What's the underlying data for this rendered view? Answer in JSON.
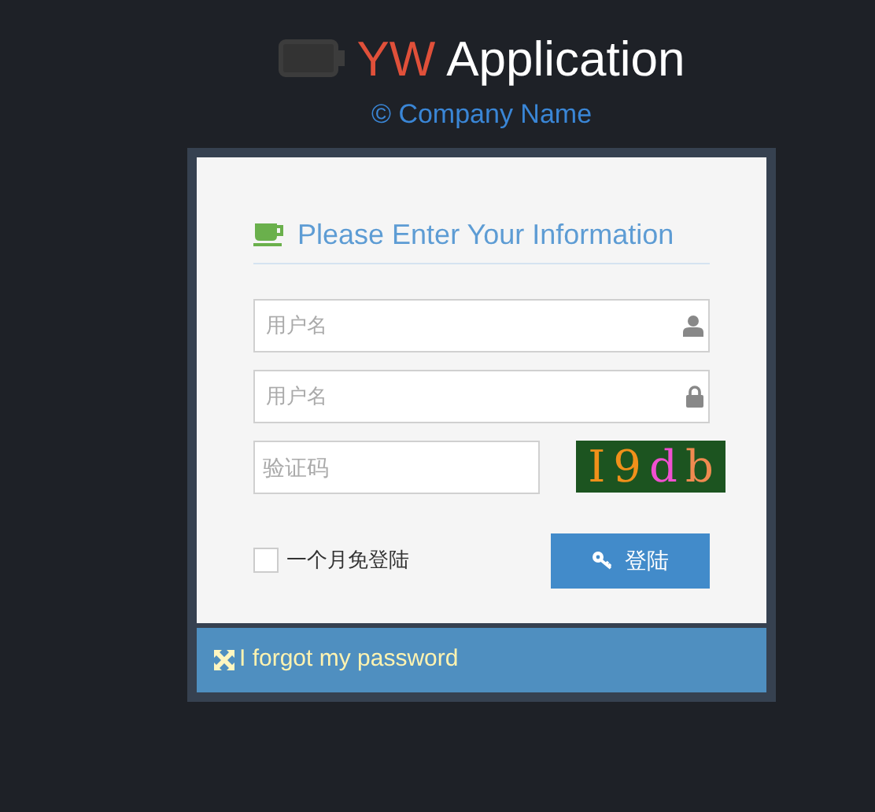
{
  "header": {
    "title_accent": "YW",
    "title": "Application",
    "company": "© Company Name"
  },
  "form": {
    "heading": "Please Enter Your Information",
    "fields": [
      {
        "kind": "user",
        "placeholder": "用户名"
      },
      {
        "kind": "lock",
        "placeholder": "用户名"
      }
    ],
    "captcha_field": {
      "placeholder": "验证码"
    },
    "captcha": [
      {
        "char": "I",
        "color": "#f0901a"
      },
      {
        "char": "9",
        "color": "#f0901a"
      },
      {
        "char": "d",
        "color": "#f050d0"
      },
      {
        "char": "b",
        "color": "#f08a50"
      }
    ],
    "remember": {
      "label": "一个月免登陆",
      "checked": false
    },
    "login_button": "登陆"
  },
  "footer": {
    "link": "I forgot my password"
  }
}
